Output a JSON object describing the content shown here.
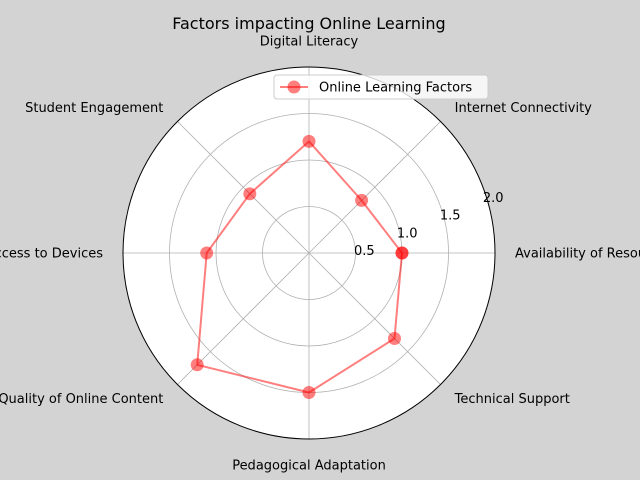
{
  "chart_data": {
    "type": "radar",
    "title": "Factors impacting Online Learning",
    "categories": [
      "Availability of Resources",
      "Internet Connectivity",
      "Digital Literacy",
      "Student Engagement",
      "Access to Devices",
      "Quality of Online Content",
      "Pedagogical Adaptation",
      "Technical Support"
    ],
    "series": [
      {
        "name": "Online Learning Factors",
        "values": [
          1.0,
          0.8,
          1.2,
          0.9,
          1.1,
          1.7,
          1.5,
          1.3
        ],
        "color": "#ff0000"
      }
    ],
    "rticks": [
      "0.5",
      "1.0",
      "1.5",
      "2.0"
    ],
    "rlim": [
      0,
      2.0
    ],
    "grid": true,
    "legend": "top-right",
    "background_color": "#d3d3d3",
    "plot_background_color": "#ffffff"
  }
}
